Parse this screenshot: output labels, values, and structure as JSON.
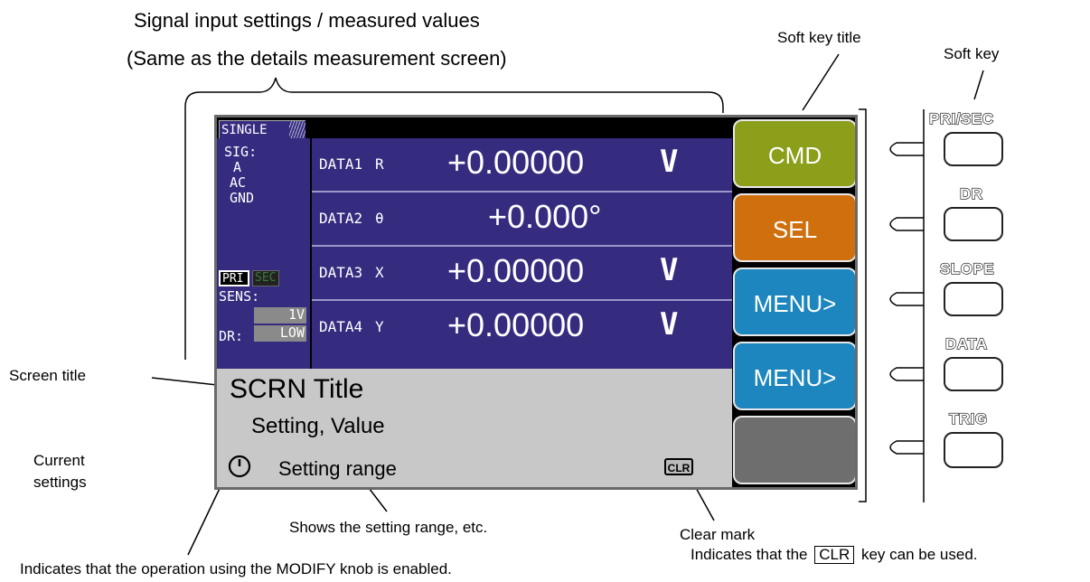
{
  "annotations": {
    "signal_title_line1": "Signal input settings / measured values",
    "signal_title_line2": "(Same as the details measurement screen)",
    "soft_key_title": "Soft key title",
    "soft_key": "Soft key",
    "screen_title": "Screen title",
    "current_settings_line1": "Current",
    "current_settings_line2": "settings",
    "setting_range_note": "Shows the setting range, etc.",
    "clear_mark": "Clear mark",
    "clear_note_prefix": "Indicates that the",
    "clear_note_key": "CLR",
    "clear_note_suffix": "key can be used.",
    "modify_note": "Indicates that the operation using the MODIFY knob is enabled."
  },
  "screen": {
    "mode_tab": "SINGLE",
    "sig_label": "SIG:",
    "sig_input": "A",
    "sig_coupling": "AC",
    "sig_ground": "GND",
    "pri_tag": "PRI",
    "sec_tag": "SEC",
    "sens_label": "SENS:",
    "sens_value": "1V",
    "dr_label": "DR:",
    "dr_value": "LOW",
    "rows": [
      {
        "label": "DATA1",
        "symbol": "R",
        "value": "+0.00000",
        "unit": "V"
      },
      {
        "label": "DATA2",
        "symbol": "θ",
        "value": "+0.000°",
        "unit": ""
      },
      {
        "label": "DATA3",
        "symbol": "X",
        "value": "+0.00000",
        "unit": "V"
      },
      {
        "label": "DATA4",
        "symbol": "Y",
        "value": "+0.00000",
        "unit": "V"
      }
    ],
    "scrn_title": "SCRN Title",
    "setting_value": "Setting, Value",
    "setting_range": "Setting range",
    "clr_mark": "CLR",
    "soft_keys": [
      {
        "label": "CMD",
        "color": "#8c9e1a"
      },
      {
        "label": "SEL",
        "color": "#cf6f0e"
      },
      {
        "label": "MENU>",
        "color": "#1d86bf"
      },
      {
        "label": "MENU>",
        "color": "#1d86bf"
      },
      {
        "label": "",
        "color": "#6e6e6e"
      }
    ]
  },
  "hardware_keys": [
    "PRI/SEC",
    "DR",
    "SLOPE",
    "DATA",
    "TRIG"
  ],
  "colors": {
    "panel_blue": "#352c80",
    "bottom_gray": "#c8c8c8"
  }
}
